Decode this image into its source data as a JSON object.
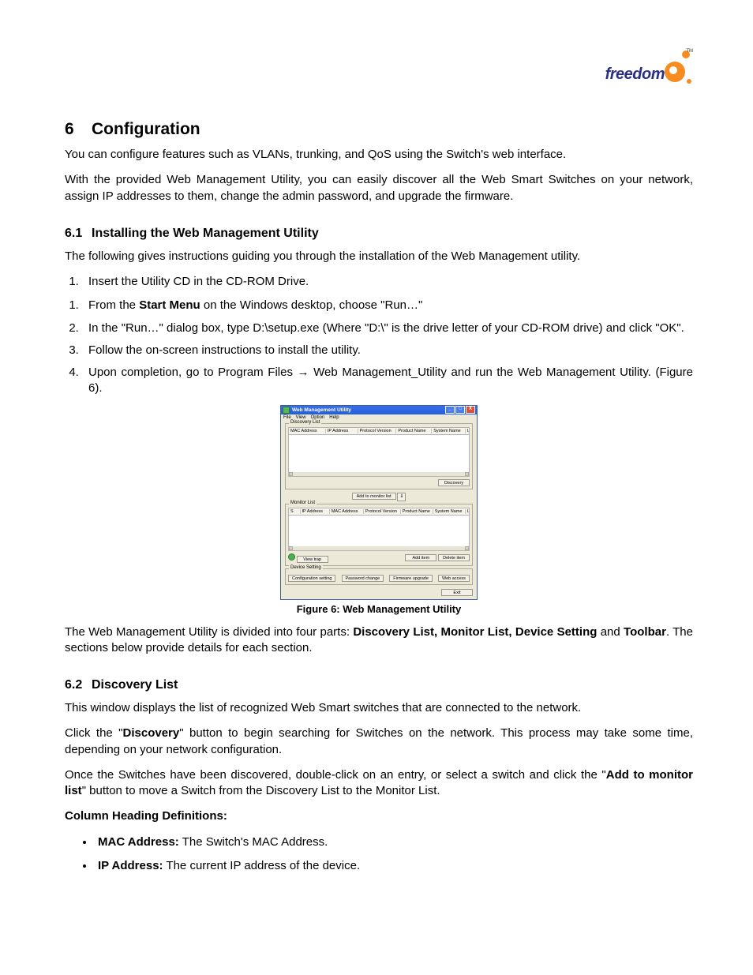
{
  "logo": {
    "text": "freedom",
    "tm": "TM"
  },
  "h1_num": "6",
  "h1_title": "Configuration",
  "intro1": "You can configure features such as VLANs, trunking, and QoS using the Switch's web interface.",
  "intro2": "With the provided Web Management Utility, you can easily discover all the Web Smart Switches on your network, assign IP addresses to them, change the admin password, and upgrade the firmware.",
  "s61_num": "6.1",
  "s61_title": "Installing the Web Management Utility",
  "s61_intro": "The following gives instructions guiding you through the installation of the Web Management utility.",
  "steps": {
    "s0": "Insert the Utility CD in the CD-ROM Drive.",
    "s1_a": "From the ",
    "s1_b": "Start Menu",
    "s1_c": " on the Windows desktop, choose \"Run…\"",
    "s2": "In the \"Run…\" dialog box, type D:\\setup.exe (Where \"D:\\\" is the drive letter of your CD-ROM drive) and click \"OK\".",
    "s3": "Follow the on-screen instructions to install the utility.",
    "s4": "Upon completion, go to Program Files → Web Management_Utility and run the Web Management Utility. (Figure 6)."
  },
  "app": {
    "title": "Web Management Utility",
    "menu": {
      "file": "File",
      "view": "View",
      "option": "Option",
      "help": "Help"
    },
    "discovery": {
      "label": "Discovery List",
      "cols": {
        "mac": "MAC Address",
        "ip": "IP Address",
        "proto": "Protocol Version",
        "prod": "Product Name",
        "sys": "System Name",
        "loc": "Loc"
      },
      "btn": "Discovery"
    },
    "addto": "Add to monitor list",
    "monitor": {
      "label": "Monitor List",
      "cols": {
        "s": "S",
        "ip": "IP Address",
        "mac": "MAC Address",
        "proto": "Protocol Version",
        "prod": "Product Name",
        "sys": "System Name",
        "loc": "Loc"
      },
      "viewtrap": "View trap",
      "add": "Add item",
      "del": "Delete item"
    },
    "device": {
      "label": "Device Setting",
      "conf": "Configuration setting",
      "pwd": "Password change",
      "fw": "Firmware upgrade",
      "web": "Web access"
    },
    "exit": "Exit"
  },
  "fig_caption": "Figure 6: Web Management Utility",
  "divided_a": "The Web Management Utility is divided into four parts: ",
  "divided_b": "Discovery List, Monitor List, Device Setting",
  "divided_c": " and ",
  "divided_d": "Toolbar",
  "divided_e": ".  The sections below provide details for each section.",
  "s62_num": "6.2",
  "s62_title": "Discovery List",
  "s62_p1": "This window displays the list of recognized Web Smart switches that are connected to the network.",
  "s62_p2_a": "Click the \"",
  "s62_p2_b": "Discovery",
  "s62_p2_c": "\" button to begin searching for Switches on the network.  This process may take some time, depending on your network configuration.",
  "s62_p3_a": "Once the Switches have been discovered, double-click on an entry, or select a switch and click the \"",
  "s62_p3_b": "Add to monitor list",
  "s62_p3_c": "\" button to move a Switch from the Discovery List to the Monitor List.",
  "coldef_title": "Column Heading Definitions:",
  "coldef": {
    "mac_l": "MAC Address:",
    "mac_d": " The Switch's MAC Address.",
    "ip_l": "IP Address:",
    "ip_d": " The current IP address of the device."
  }
}
